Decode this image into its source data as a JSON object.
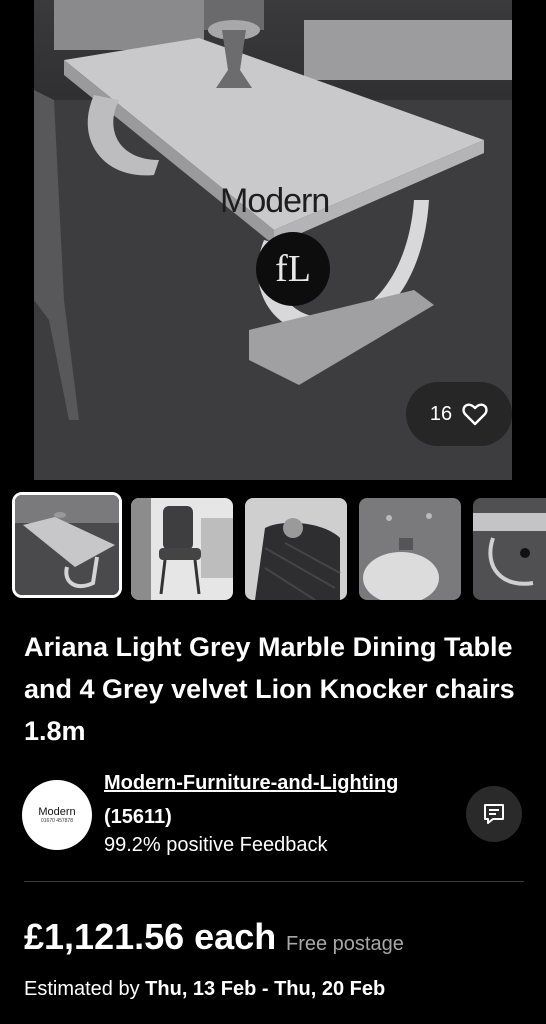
{
  "gallery": {
    "like_count": "16",
    "watermark_word": "Modern",
    "watermark_logo": "fL",
    "thumbnails": [
      {
        "name": "table-photo",
        "selected": true
      },
      {
        "name": "chair-photo",
        "selected": false
      },
      {
        "name": "lion-knocker-photo",
        "selected": false
      },
      {
        "name": "velvet-detail-photo",
        "selected": false
      },
      {
        "name": "table-side-photo",
        "selected": false
      }
    ]
  },
  "listing": {
    "title": "Ariana Light Grey Marble Dining Table and 4 Grey velvet Lion Knocker chairs 1.8m"
  },
  "seller": {
    "name": "Modern-Furniture-and-Lighting",
    "count": "(15611)",
    "feedback": "99.2% positive Feedback",
    "avatar_word": "Modern",
    "avatar_phone": "01670 457878"
  },
  "price": {
    "amount": "£1,121.56 each",
    "postage": "Free postage",
    "estimate_prefix": "Estimated by",
    "estimate_dates": "Thu, 13 Feb - Thu, 20 Feb"
  },
  "icons": {
    "like": "heart-icon",
    "message": "message-icon"
  }
}
